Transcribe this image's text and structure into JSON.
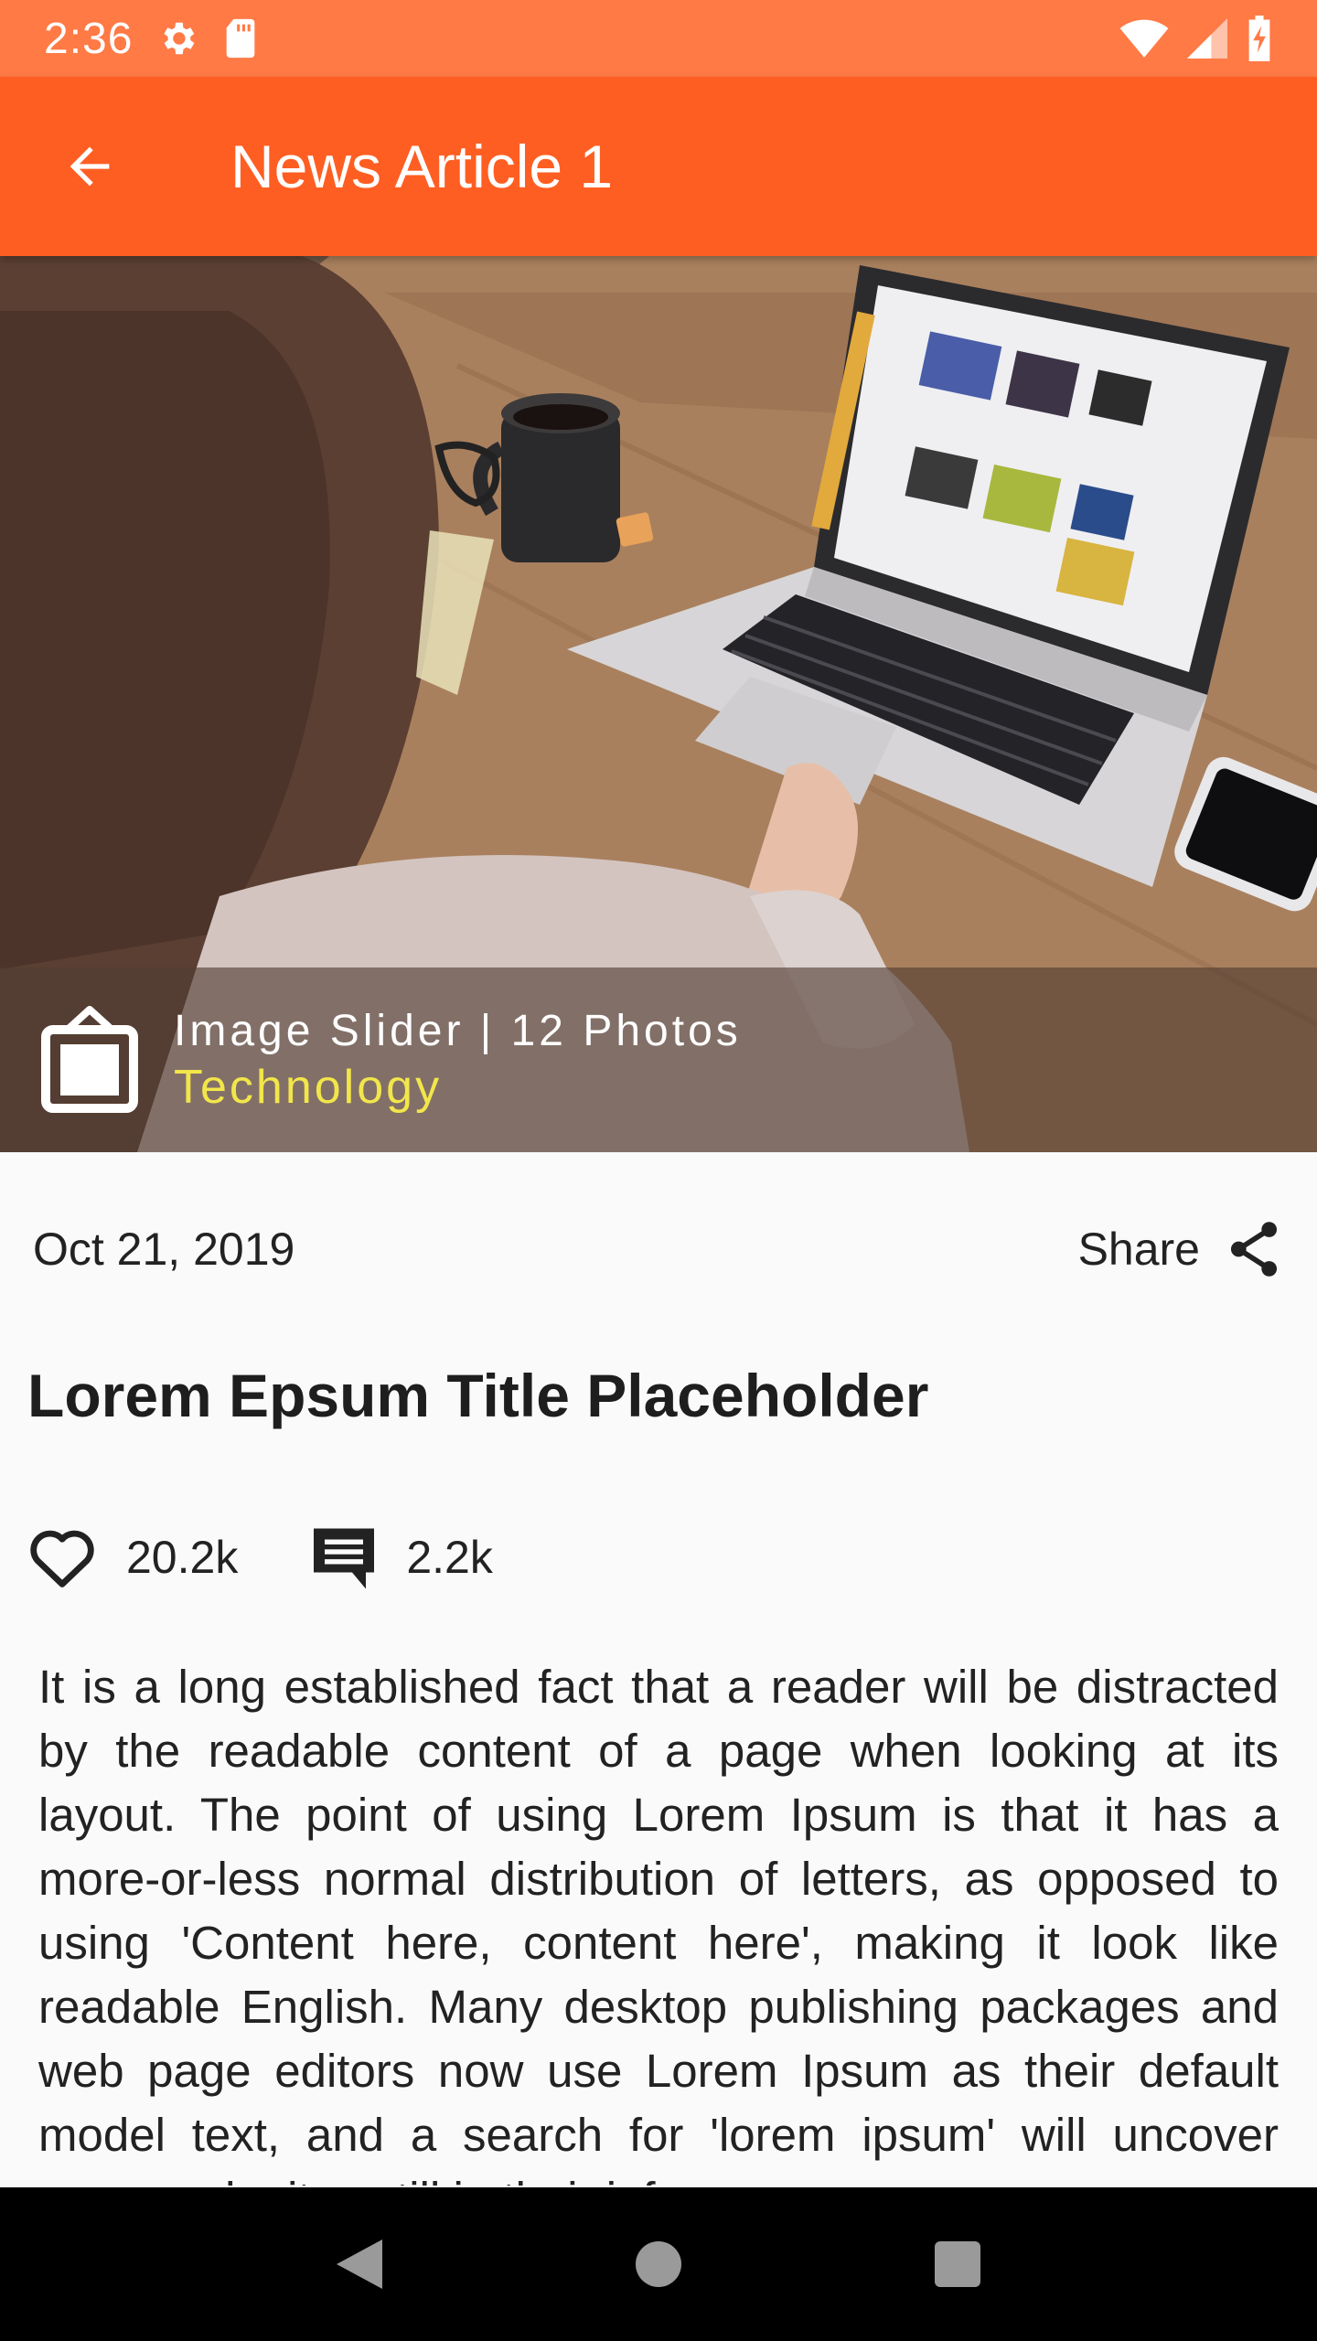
{
  "status_bar": {
    "time": "2:36",
    "icons": [
      "gear-icon",
      "sd-card-icon",
      "wifi-icon",
      "signal-icon",
      "battery-charging-icon"
    ]
  },
  "app_bar": {
    "back_icon": "arrow-back-icon",
    "title": "News Article 1",
    "color": "#ff5e22"
  },
  "hero": {
    "image_description_icon": "gallery-icon",
    "caption_title": "Image Slider | 12 Photos",
    "category": "Technology",
    "category_color": "#f2e64a"
  },
  "article": {
    "date": "Oct 21, 2019",
    "share_label": "Share",
    "title": "Lorem Epsum Title Placeholder",
    "likes": "20.2k",
    "comments": "2.2k",
    "body": "It is a long established fact that a reader will be distracted by the readable content of a page when looking at its layout. The point of using Lorem Ipsum is that it has a more-or-less normal distribution of letters, as opposed to using 'Content here, content here', making it look like readable English. Many desktop publishing packages and web page editors now use Lorem Ipsum as their default model text, and a search for 'lorem ipsum' will uncover many web sites still in their infancy."
  },
  "nav_bar": {
    "buttons": [
      "back-triangle-icon",
      "home-circle-icon",
      "recents-square-icon"
    ]
  }
}
